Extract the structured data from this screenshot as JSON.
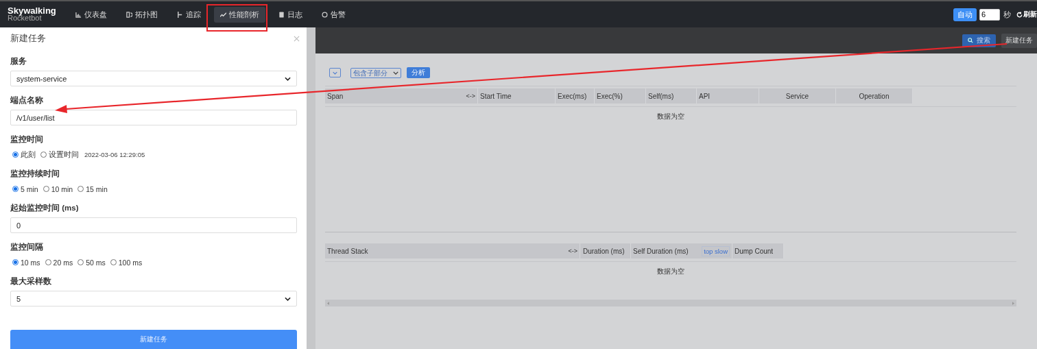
{
  "header": {
    "logo": {
      "title": "Skywalking",
      "subtitle": "Rocketbot"
    },
    "nav": [
      {
        "label": "仪表盘",
        "selected": false
      },
      {
        "label": "拓扑图",
        "selected": false
      },
      {
        "label": "追踪",
        "selected": false
      },
      {
        "label": "性能剖析",
        "selected": true
      },
      {
        "label": "日志",
        "selected": false
      },
      {
        "label": "告警",
        "selected": false
      }
    ],
    "auto_button": "自动",
    "interval": "6",
    "interval_unit": "秒",
    "refresh": "刷新"
  },
  "toolbar": {
    "search_button": "搜索",
    "new_task_button": "新建任务"
  },
  "drawer": {
    "title": "新建任务",
    "fields": [
      {
        "kind": "select",
        "label": "服务",
        "value": "system-service"
      },
      {
        "kind": "input",
        "label": "端点名称",
        "value": "/v1/user/list"
      },
      {
        "kind": "radio",
        "label": "监控时间",
        "options": [
          {
            "label": "此刻",
            "selected": true
          },
          {
            "label": "设置时间",
            "selected": false
          }
        ],
        "note": "2022-03-06 12:29:05"
      },
      {
        "kind": "radio",
        "label": "监控持续时间",
        "options": [
          {
            "label": "5 min",
            "selected": true
          },
          {
            "label": "10 min",
            "selected": false
          },
          {
            "label": "15 min",
            "selected": false
          }
        ]
      },
      {
        "kind": "input",
        "label": "起始监控时间 (ms)",
        "value": "0"
      },
      {
        "kind": "radio",
        "label": "监控间隔",
        "options": [
          {
            "label": "10 ms",
            "selected": true
          },
          {
            "label": "20 ms",
            "selected": false
          },
          {
            "label": "50 ms",
            "selected": false
          },
          {
            "label": "100 ms",
            "selected": false
          }
        ]
      },
      {
        "kind": "select",
        "label": "最大采样数",
        "value": "5"
      }
    ],
    "submit_button": "新建任务"
  },
  "trace_panel": {
    "filter": "包含子部分",
    "analyze_button": "分析",
    "columns": [
      {
        "label": "Span",
        "resize": "<->"
      },
      {
        "label": "Start Time"
      },
      {
        "label": "Exec(ms)"
      },
      {
        "label": "Exec(%)"
      },
      {
        "label": "Self(ms)"
      },
      {
        "label": "API"
      },
      {
        "label": "Service"
      },
      {
        "label": "Operation"
      }
    ],
    "empty": "数据为空"
  },
  "thread_panel": {
    "columns": [
      {
        "label": "Thread Stack",
        "resize": "<->"
      },
      {
        "label": "Duration (ms)"
      },
      {
        "label": "Self Duration (ms)",
        "button": "top slow"
      },
      {
        "label": "Dump Count"
      }
    ],
    "empty": "数据为空"
  }
}
